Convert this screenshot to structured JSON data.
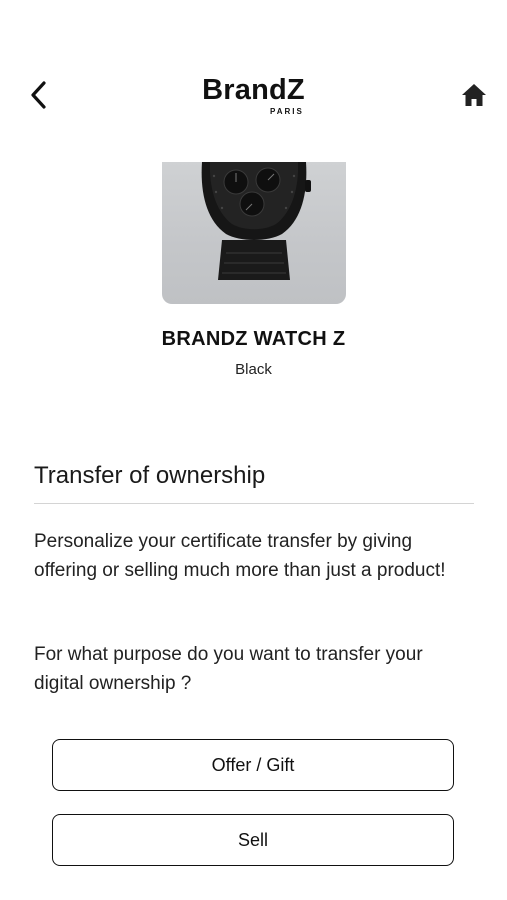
{
  "header": {
    "brand_name": "BrandZ",
    "brand_sub": "PARIS",
    "back_icon": "chevron-left-icon",
    "home_icon": "home-icon"
  },
  "product": {
    "title": "BRANDZ WATCH Z",
    "color": "Black",
    "image": "watch-image"
  },
  "transfer": {
    "title": "Transfer of ownership",
    "description": "Personalize your certificate transfer by giving offering or selling much more than just a product!",
    "question": "For what purpose do you want to transfer your digital ownership ?"
  },
  "actions": {
    "offer_label": "Offer / Gift",
    "sell_label": "Sell"
  }
}
